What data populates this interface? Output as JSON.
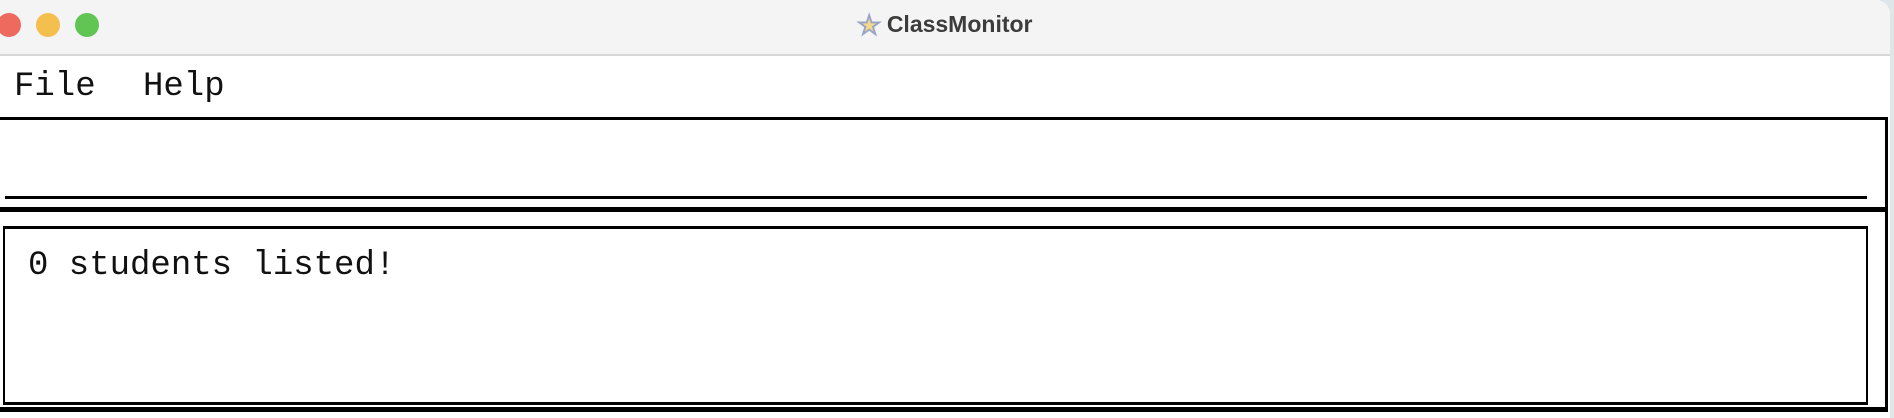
{
  "window": {
    "title": "ClassMonitor",
    "app_icon": "star-icon"
  },
  "menubar": {
    "items": [
      {
        "label": "File"
      },
      {
        "label": "Help"
      }
    ]
  },
  "command_box": {
    "value": "",
    "placeholder": ""
  },
  "result_display": {
    "text": "0 students listed!"
  },
  "colors": {
    "close": "#ee6a5e",
    "minimize": "#f5bf4f",
    "zoom": "#61c554"
  }
}
